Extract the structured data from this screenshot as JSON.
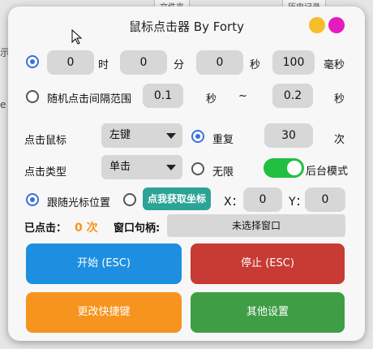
{
  "background": {
    "tab_file": "文件夹",
    "tab_history": "历史记录",
    "side_text_1": "示",
    "side_text_2": "e"
  },
  "window": {
    "title": "鼠标点击器 By Forty",
    "accent_yellow": "#f7bd2a",
    "accent_magenta": "#e51bbf"
  },
  "timer": {
    "hours": "0",
    "hours_label": "时",
    "minutes": "0",
    "minutes_label": "分",
    "seconds": "0",
    "seconds_label": "秒",
    "millis": "100",
    "millis_label": "毫秒"
  },
  "random": {
    "label": "随机点击间隔范围",
    "min": "0.1",
    "min_unit": "秒",
    "sep": "~",
    "max": "0.2",
    "max_unit": "秒"
  },
  "mouse": {
    "label": "点击鼠标",
    "button": "左键",
    "repeat_label": "重复",
    "repeat_count": "30",
    "repeat_unit": "次"
  },
  "click_type": {
    "label": "点击类型",
    "value": "单击",
    "infinite_label": "无限",
    "background_mode_label": "后台模式"
  },
  "position": {
    "follow_label": "跟随光标位置",
    "get_coords_button": "点我获取坐标",
    "x_label": "X：",
    "x_value": "0",
    "y_label": "Y：",
    "y_value": "0"
  },
  "status": {
    "clicked_label": "已点击：",
    "clicked_count": "0 次",
    "handle_label": "窗口句柄:",
    "handle_value": "未选择窗口"
  },
  "buttons": {
    "start": "开始 (ESC)",
    "stop": "停止 (ESC)",
    "hotkey": "更改快捷键",
    "other": "其他设置",
    "start_color": "#1e8fe0",
    "stop_color": "#c83a34",
    "hotkey_color": "#f7941d",
    "other_color": "#3f9e45"
  }
}
